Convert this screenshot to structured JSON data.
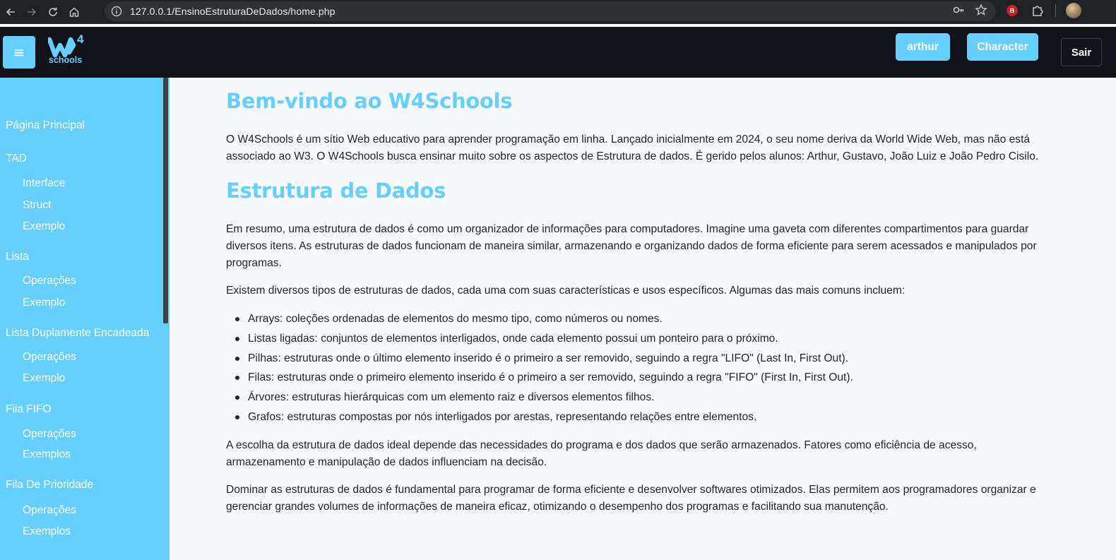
{
  "browser": {
    "url": "127.0.0.1/EnsinoEstruturaDeDados/home.php",
    "extension_badge": "B"
  },
  "header": {
    "logo_superscript": "4",
    "logo_text": "schools",
    "user_button": "arthur",
    "character_button": "Character",
    "exit_button": "Sair"
  },
  "sidebar": {
    "items": [
      {
        "label": "Página Principal",
        "level": 0
      },
      {
        "label": "TAD",
        "level": 0
      },
      {
        "label": "Interface",
        "level": 1
      },
      {
        "label": "Struct",
        "level": 1
      },
      {
        "label": "Exemplo",
        "level": 1
      },
      {
        "label": "Lista",
        "level": 0
      },
      {
        "label": "Operações",
        "level": 1
      },
      {
        "label": "Exemplo",
        "level": 1
      },
      {
        "label": "Lista Duplamente Encadeada",
        "level": 0
      },
      {
        "label": "Operações",
        "level": 1
      },
      {
        "label": "Exemplo",
        "level": 1
      },
      {
        "label": "Fila FIFO",
        "level": 0
      },
      {
        "label": "Operações",
        "level": 1
      },
      {
        "label": "Exemplos",
        "level": 1
      },
      {
        "label": "Fila De Prioridade",
        "level": 0
      },
      {
        "label": "Operações",
        "level": 1
      },
      {
        "label": "Exemplos",
        "level": 1
      }
    ]
  },
  "main": {
    "title1": "Bem-vindo ao W4Schools",
    "intro": "O W4Schools é um sítio Web educativo para aprender programação em linha. Lançado inicialmente em 2024, o seu nome deriva da World Wide Web, mas não está associado ao W3. O W4Schools busca ensinar muito sobre os aspectos de Estrutura de dados. É gerido pelos alunos: Arthur, Gustavo, João Luiz e João Pedro Cisilo.",
    "title2": "Estrutura de Dados",
    "p1": "Em resumo, uma estrutura de dados é como um organizador de informações para computadores. Imagine uma gaveta com diferentes compartimentos para guardar diversos itens. As estruturas de dados funcionam de maneira similar, armazenando e organizando dados de forma eficiente para serem acessados e manipulados por programas.",
    "p2": "Existem diversos tipos de estruturas de dados, cada uma com suas características e usos específicos. Algumas das mais comuns incluem:",
    "list": [
      "Arrays: coleções ordenadas de elementos do mesmo tipo, como números ou nomes.",
      "Listas ligadas: conjuntos de elementos interligados, onde cada elemento possui um ponteiro para o próximo.",
      "Pilhas: estruturas onde o último elemento inserido é o primeiro a ser removido, seguindo a regra \"LIFO\" (Last In, First Out).",
      "Filas: estruturas onde o primeiro elemento inserido é o primeiro a ser removido, seguindo a regra \"FIFO\" (First In, First Out).",
      "Árvores: estruturas hierárquicas com um elemento raiz e diversos elementos filhos.",
      "Grafos: estruturas compostas por nós interligados por arestas, representando relações entre elementos."
    ],
    "p3": "A escolha da estrutura de dados ideal depende das necessidades do programa e dos dados que serão armazenados. Fatores como eficiência de acesso, armazenamento e manipulação de dados influenciam na decisão.",
    "p4": "Dominar as estruturas de dados é fundamental para programar de forma eficiente e desenvolver softwares otimizados. Elas permitem aos programadores organizar e gerenciar grandes volumes de informações de maneira eficaz, otimizando o desempenho dos programas e facilitando sua manutenção."
  },
  "colors": {
    "accent": "#66cfff",
    "header_bg": "#111318",
    "page_bg": "#f8f9fb",
    "text": "#212529"
  }
}
